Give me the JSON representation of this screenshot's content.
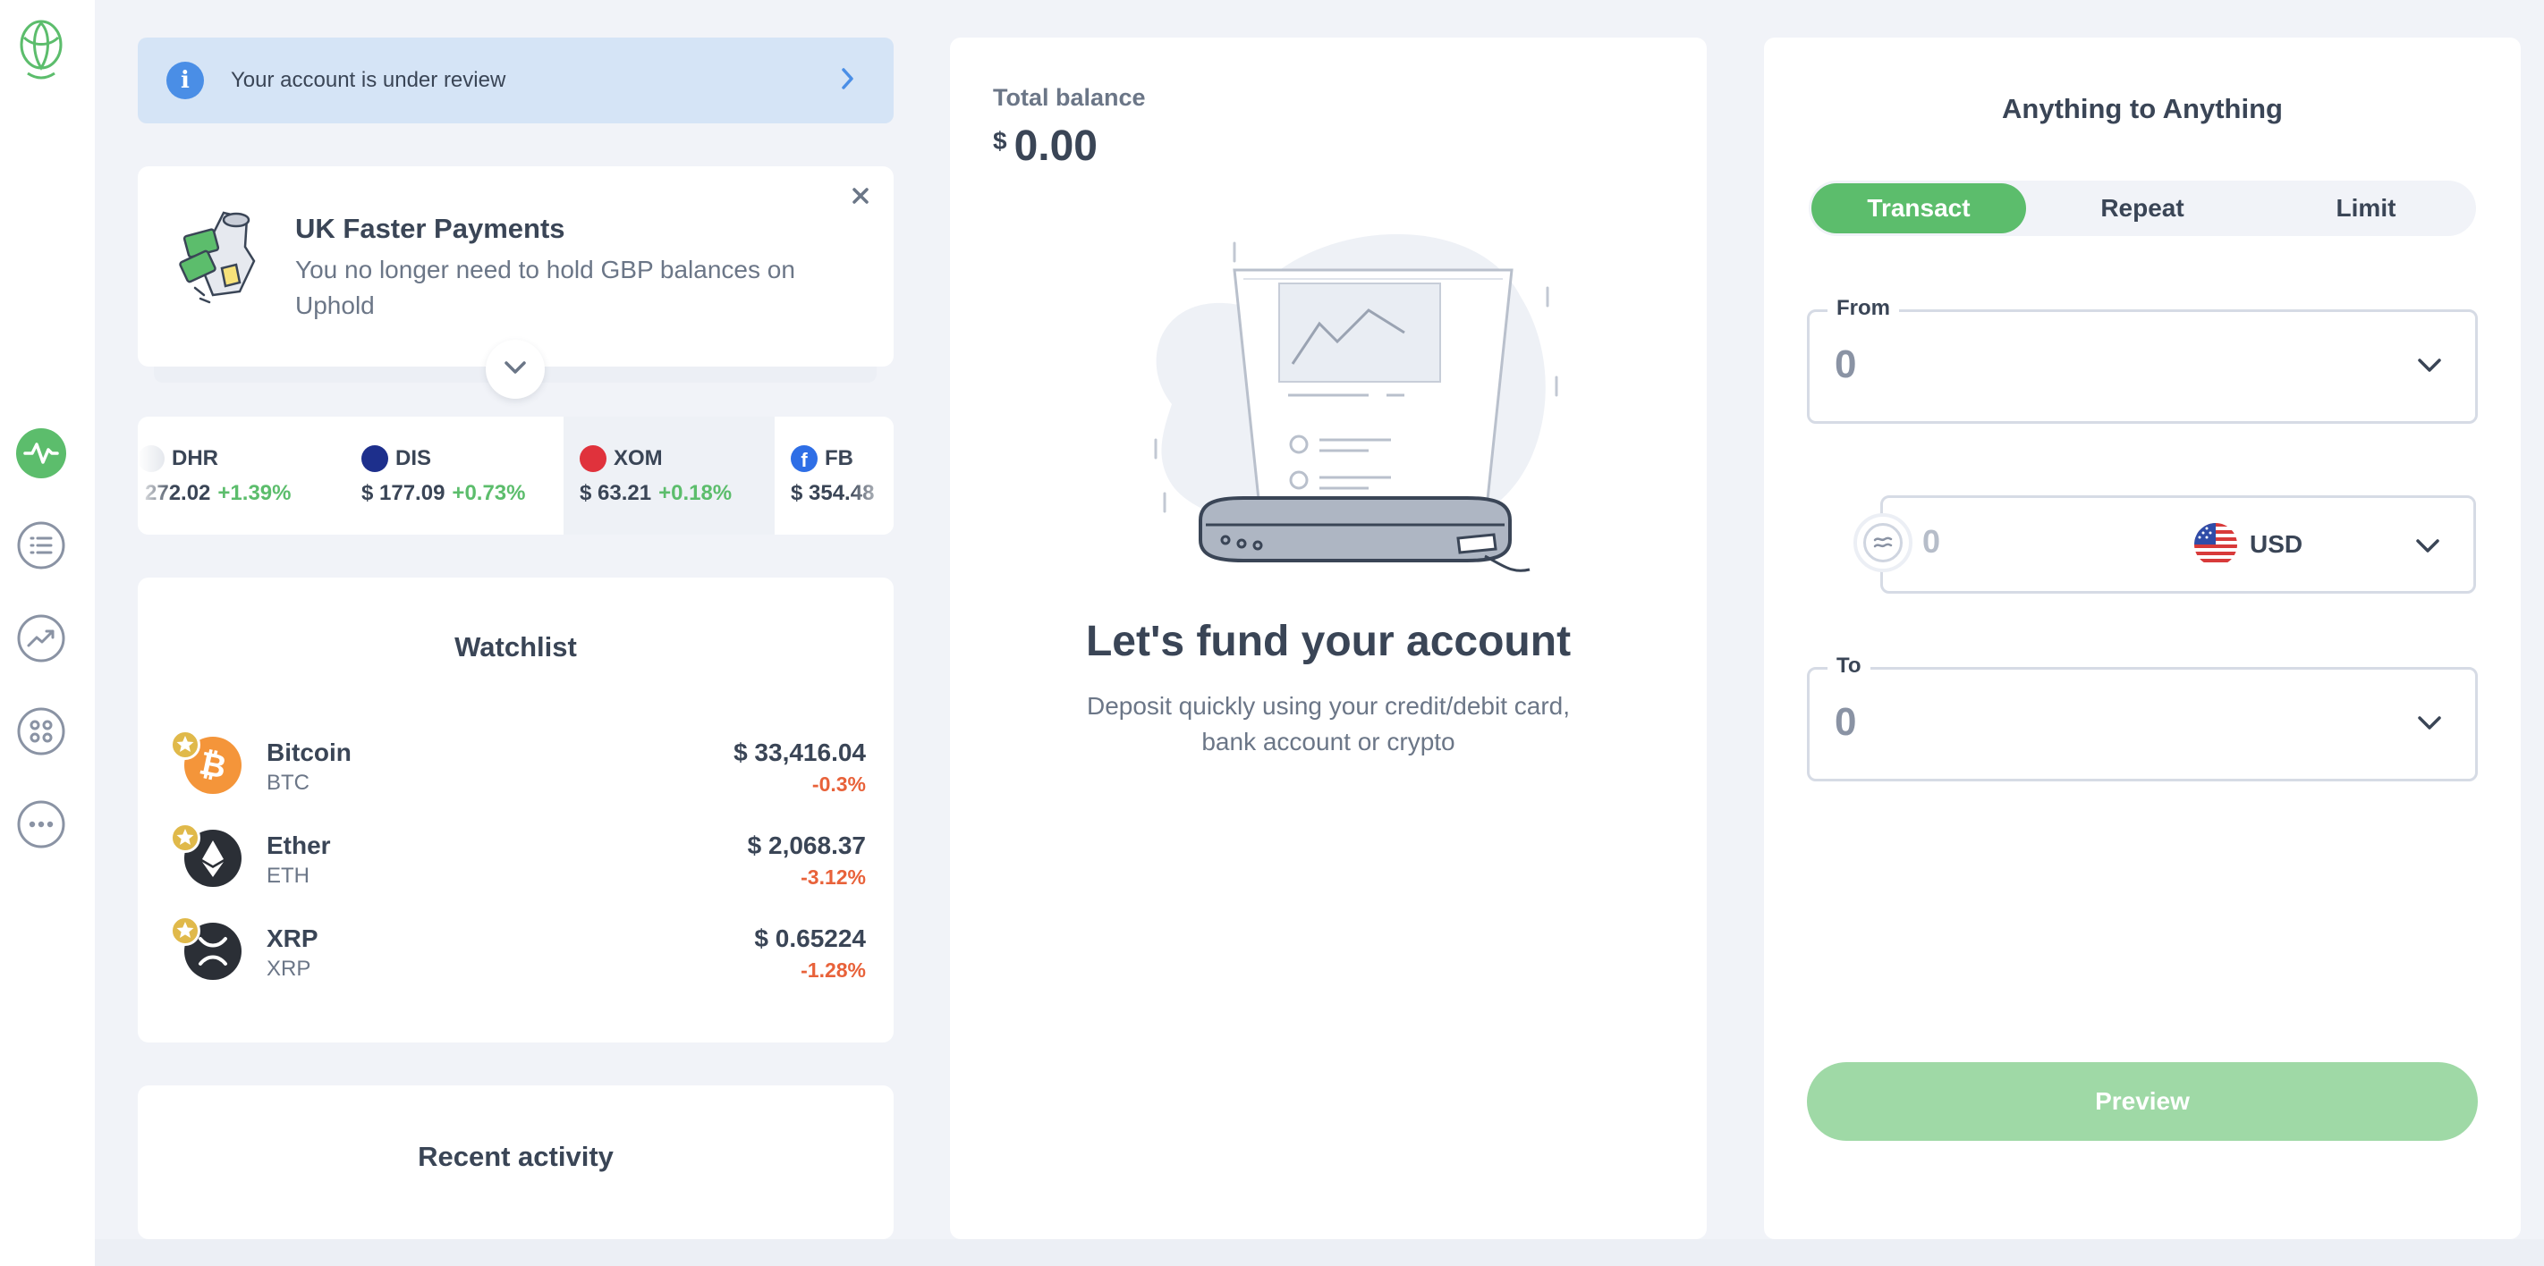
{
  "banner": {
    "text": "Your account is under review",
    "icon": "info-icon"
  },
  "promo": {
    "title": "UK Faster Payments",
    "description": "You no longer need to hold GBP balances on Uphold"
  },
  "ticker": [
    {
      "symbol": "DHR",
      "price": "272.02",
      "change": "+1.39%"
    },
    {
      "symbol": "DIS",
      "price": "$ 177.09",
      "change": "+0.73%"
    },
    {
      "symbol": "XOM",
      "price": "$ 63.21",
      "change": "+0.18%"
    },
    {
      "symbol": "FB",
      "price": "$ 354.48",
      "change": ""
    }
  ],
  "watchlist": {
    "title": "Watchlist",
    "items": [
      {
        "name": "Bitcoin",
        "code": "BTC",
        "price": "$ 33,416.04",
        "change": "-0.3%",
        "color": "#f4953a"
      },
      {
        "name": "Ether",
        "code": "ETH",
        "price": "$ 2,068.37",
        "change": "-3.12%",
        "color": "#2b2f36"
      },
      {
        "name": "XRP",
        "code": "XRP",
        "price": "$ 0.65224",
        "change": "-1.28%",
        "color": "#2b2f36"
      }
    ]
  },
  "recent": {
    "title": "Recent activity"
  },
  "balance": {
    "label": "Total balance",
    "currency_symbol": "$",
    "amount": "0.00",
    "fund_title": "Let's fund your account",
    "fund_desc": "Deposit quickly using your credit/debit card, bank account or crypto"
  },
  "transact": {
    "title": "Anything to Anything",
    "tabs": [
      "Transact",
      "Repeat",
      "Limit"
    ],
    "from": {
      "label": "From",
      "value": "0"
    },
    "amount": {
      "value": "0",
      "currency": "USD"
    },
    "to": {
      "label": "To",
      "value": "0"
    },
    "preview": "Preview"
  },
  "colors": {
    "accent": "#5cbd6c",
    "negative": "#e8623a",
    "banner_bg": "#d5e4f6",
    "info": "#4a8ee6"
  },
  "icons": {
    "rail": [
      "uphold-logo-icon",
      "activity-icon",
      "list-icon",
      "trending-icon",
      "assets-icon",
      "more-icon"
    ]
  }
}
